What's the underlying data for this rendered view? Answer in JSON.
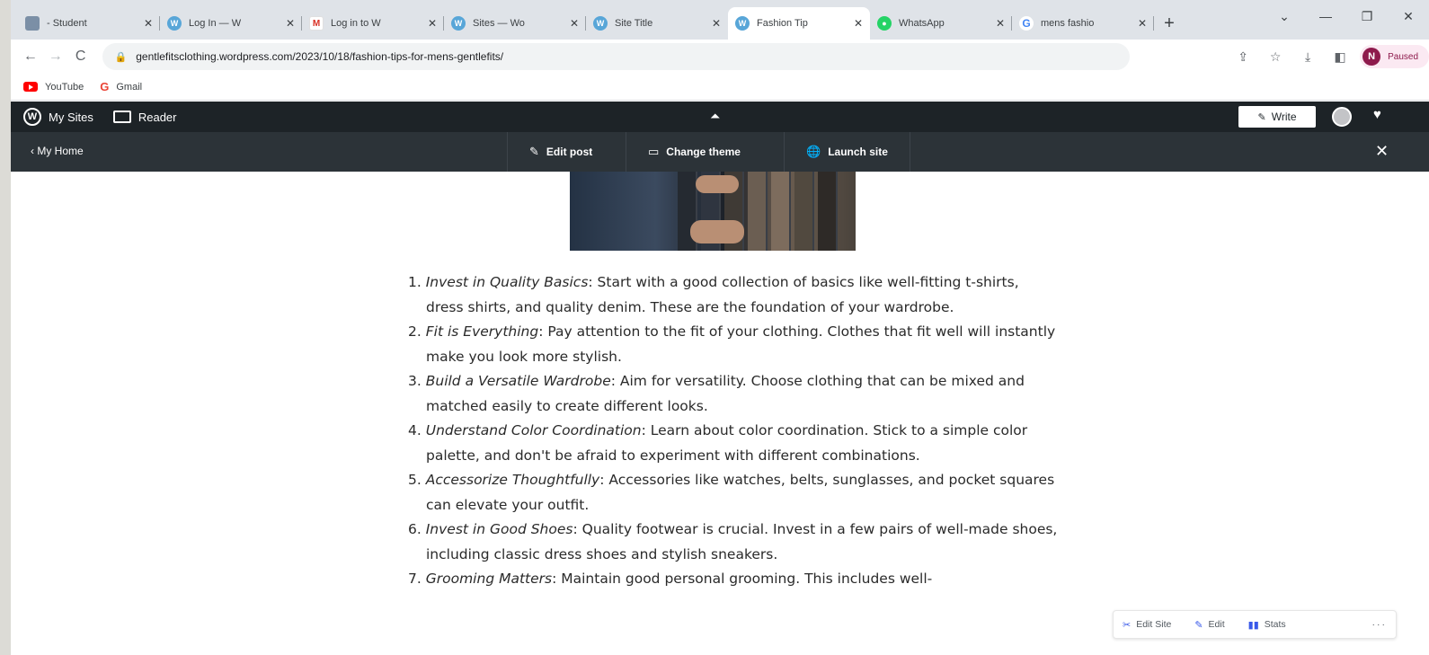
{
  "tabs": [
    {
      "title": "- Student",
      "favicon": "student-icon",
      "active": false
    },
    {
      "title": "Log In — W",
      "favicon": "wordpress-icon",
      "active": false
    },
    {
      "title": "Log in to W",
      "favicon": "gmail-icon",
      "active": false
    },
    {
      "title": "Sites — Wo",
      "favicon": "wordpress-icon",
      "active": false
    },
    {
      "title": "Site Title",
      "favicon": "wordpress-icon",
      "active": false
    },
    {
      "title": "Fashion Tip",
      "favicon": "wordpress-icon",
      "active": true
    },
    {
      "title": "WhatsApp",
      "favicon": "whatsapp-icon",
      "active": false
    },
    {
      "title": "mens fashio",
      "favicon": "google-icon",
      "active": false
    }
  ],
  "toolbar": {
    "url": "gentlefitsclothing.wordpress.com/2023/10/18/fashion-tips-for-mens-gentlefits/",
    "profile_initial": "N",
    "profile_label": "Paused"
  },
  "bookmarks": [
    {
      "label": "YouTube",
      "icon": "youtube-icon"
    },
    {
      "label": "Gmail",
      "icon": "google-icon"
    }
  ],
  "masterbar": {
    "my_sites": "My Sites",
    "reader": "Reader",
    "write": "Write"
  },
  "sitebar": {
    "my_home": "My Home",
    "edit_post": "Edit post",
    "change_theme": "Change theme",
    "launch_site": "Launch site"
  },
  "post": {
    "tips": [
      {
        "number": "1.",
        "title": "Invest in Quality Basics",
        "text": ": Start with a good collection of basics like well-fitting t-shirts, dress shirts, and quality denim. These are the foundation of your wardrobe."
      },
      {
        "number": "2.",
        "title": "Fit is Everything",
        "text": ": Pay attention to the fit of your clothing. Clothes that fit well will instantly make you look more stylish."
      },
      {
        "number": "3.",
        "title": "Build a Versatile Wardrobe",
        "text": ": Aim for versatility. Choose clothing that can be mixed and matched easily to create different looks."
      },
      {
        "number": "4.",
        "title": "Understand Color Coordination",
        "text": ": Learn about color coordination. Stick to a simple color palette, and don't be afraid to experiment with different combinations."
      },
      {
        "number": "5.",
        "title": "Accessorize Thoughtfully",
        "text": ": Accessories like watches, belts, sunglasses, and pocket squares can elevate your outfit."
      },
      {
        "number": "6.",
        "title": "Invest in Good Shoes",
        "text": ": Quality footwear is crucial. Invest in a few pairs of well-made shoes, including classic dress shoes and stylish sneakers."
      },
      {
        "number": "7.",
        "title": "Grooming Matters",
        "text": ": Maintain good personal grooming. This includes well-"
      }
    ]
  },
  "site_actions": {
    "edit_site": "Edit Site",
    "edit": "Edit",
    "stats": "Stats"
  },
  "colors": {
    "masterbar_bg": "#1d2327",
    "sitebar_bg": "#2c3338",
    "accent": "#3858e9",
    "profile": "#8e1a4c"
  }
}
